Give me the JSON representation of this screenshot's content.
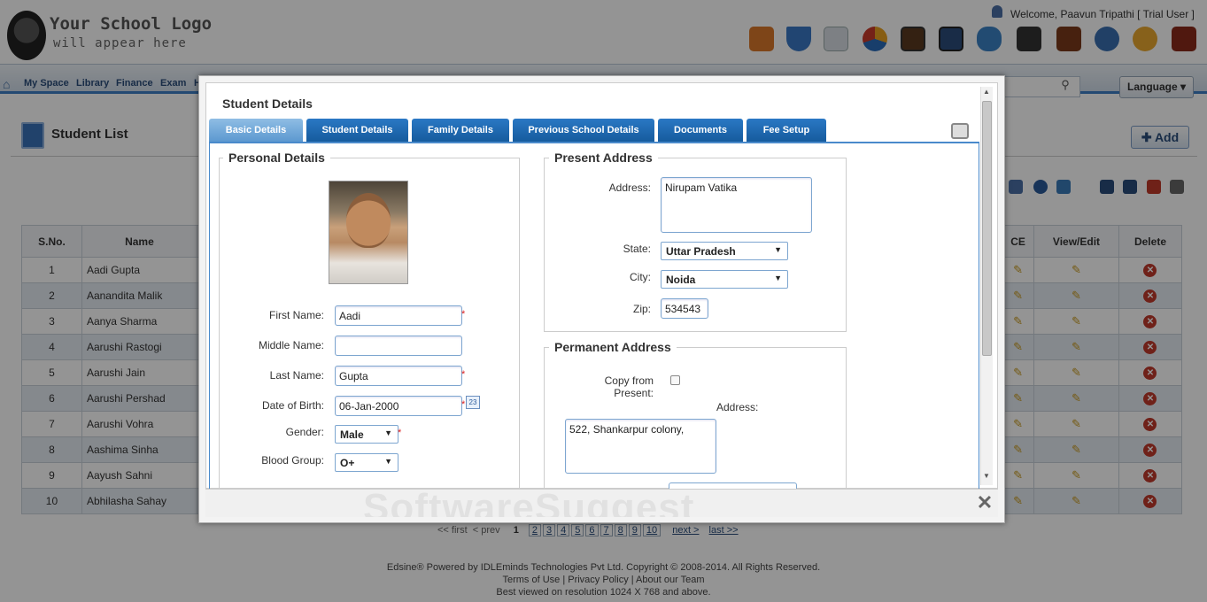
{
  "header": {
    "logo_line1": "Your School Logo",
    "logo_line2": "will appear here",
    "welcome": "Welcome, Paavun Tripathi [ Trial User ]",
    "toolbar_icons": [
      "staff-icon",
      "filter-icon",
      "mail-icon",
      "pie-chart-icon",
      "gallery-icon",
      "video-icon",
      "chat-icon",
      "cctv-icon",
      "book-icon",
      "settings-gear-icon",
      "support-icon",
      "exit-door-icon"
    ]
  },
  "nav": {
    "items": [
      "My Space",
      "Library",
      "Finance",
      "Exam",
      "H"
    ],
    "language": "Language"
  },
  "page": {
    "title": "Student List",
    "add_label": "Add",
    "columns": [
      "S.No.",
      "Name",
      "CE",
      "View/Edit",
      "Delete"
    ],
    "rows": [
      {
        "sno": "1",
        "name": "Aadi Gupta"
      },
      {
        "sno": "2",
        "name": "Aanandita Malik"
      },
      {
        "sno": "3",
        "name": "Aanya Sharma"
      },
      {
        "sno": "4",
        "name": "Aarushi Rastogi"
      },
      {
        "sno": "5",
        "name": "Aarushi Jain"
      },
      {
        "sno": "6",
        "name": "Aarushi Pershad"
      },
      {
        "sno": "7",
        "name": "Aarushi Vohra"
      },
      {
        "sno": "8",
        "name": "Aashima Sinha"
      },
      {
        "sno": "9",
        "name": "Aayush Sahni"
      },
      {
        "sno": "10",
        "name": "Abhilasha Sahay"
      }
    ],
    "pager": {
      "first": "<< first",
      "prev": "< prev",
      "current": "1",
      "pages": [
        "2",
        "3",
        "4",
        "5",
        "6",
        "7",
        "8",
        "9",
        "10"
      ],
      "next": "next >",
      "last": "last >>"
    }
  },
  "footer": {
    "line1": "Edsine® Powered by IDLEminds Technologies Pvt Ltd. Copyright © 2008-2014. All Rights Reserved.",
    "line2": "Terms of Use | Privacy Policy | About our Team",
    "line3": "Best viewed on resolution 1024 X 768 and above."
  },
  "modal": {
    "title": "Student Details",
    "tabs": [
      "Basic Details",
      "Student Details",
      "Family Details",
      "Previous School Details",
      "Documents",
      "Fee Setup"
    ],
    "active_tab": "Basic Details",
    "personal": {
      "legend": "Personal Details",
      "first_name_label": "First Name:",
      "first_name": "Aadi",
      "middle_name_label": "Middle Name:",
      "middle_name": "",
      "last_name_label": "Last Name:",
      "last_name": "Gupta",
      "dob_label": "Date of Birth:",
      "dob": "06-Jan-2000",
      "gender_label": "Gender:",
      "gender": "Male",
      "blood_group_label": "Blood Group:",
      "blood_group": "O+",
      "required_mark": "*"
    },
    "present": {
      "legend": "Present Address",
      "address_label": "Address:",
      "address": "Nirupam Vatika",
      "state_label": "State:",
      "state": "Uttar Pradesh",
      "city_label": "City:",
      "city": "Noida",
      "zip_label": "Zip:",
      "zip": "534543"
    },
    "permanent": {
      "legend": "Permanent Address",
      "copy_label": "Copy from Present:",
      "address_label": "Address:",
      "address": "522,  Shankarpur colony,"
    },
    "watermark": "SoftwareSuggest",
    "close": "✕"
  },
  "colors": {
    "tab_blue": "#155a9c",
    "tab_active": "#6fa6d8",
    "required": "#dd2222",
    "delete_red": "#c0392b"
  }
}
